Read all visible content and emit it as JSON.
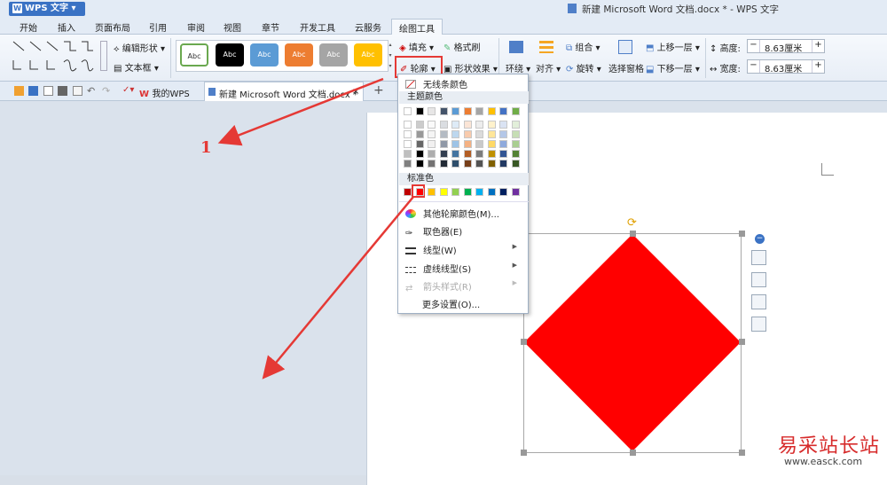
{
  "app": {
    "name": "WPS 文字",
    "window_title": "新建 Microsoft Word 文档.docx * - WPS 文字"
  },
  "menu": [
    "开始",
    "插入",
    "页面布局",
    "引用",
    "审阅",
    "视图",
    "章节",
    "开发工具",
    "云服务",
    "绘图工具"
  ],
  "ribbon": {
    "edit_shape": "编辑形状",
    "text_box": "文本框",
    "style_label": "Abc",
    "fill": "填充",
    "format_brush": "格式刷",
    "outline": "轮廓",
    "shape_effect": "形状效果",
    "wrap": "环绕",
    "align": "对齐",
    "group": "组合",
    "rotate": "旋转",
    "selection_pane": "选择窗格",
    "bring_forward": "上移一层",
    "send_backward": "下移一层",
    "height_label": "高度:",
    "height_value": "8.63厘米",
    "width_label": "宽度:",
    "width_value": "8.63厘米",
    "minus": "−",
    "plus": "+"
  },
  "tabs": {
    "my_wps": "我的WPS",
    "doc": "新建 Microsoft Word 文档.docx *",
    "close": "×",
    "add": "+"
  },
  "dropdown": {
    "no_outline": "无线条颜色",
    "theme_colors": "主题颜色",
    "standard_colors": "标准色",
    "more_colors": "其他轮廓颜色(M)...",
    "eyedropper": "取色器(E)",
    "line_type": "线型(W)",
    "dash_type": "虚线线型(S)",
    "arrow_style": "箭头样式(R)",
    "more_settings": "更多设置(O)..."
  },
  "annotation": {
    "label": "1"
  },
  "watermark": {
    "title": "易采站长站",
    "url": "www.easck.com"
  },
  "colors": {
    "shape_fill": "#ff0000",
    "annotation": "#e53935",
    "theme_top": [
      "#ffffff",
      "#000000",
      "#e7e6e6",
      "#44546a",
      "#5b9bd5",
      "#ed7d31",
      "#a5a5a5",
      "#ffc000",
      "#4472c4",
      "#70ad47"
    ],
    "standard": [
      "#c00000",
      "#ff0000",
      "#ffc000",
      "#ffff00",
      "#92d050",
      "#00b050",
      "#00b0f0",
      "#0070c0",
      "#002060",
      "#7030a0"
    ]
  }
}
